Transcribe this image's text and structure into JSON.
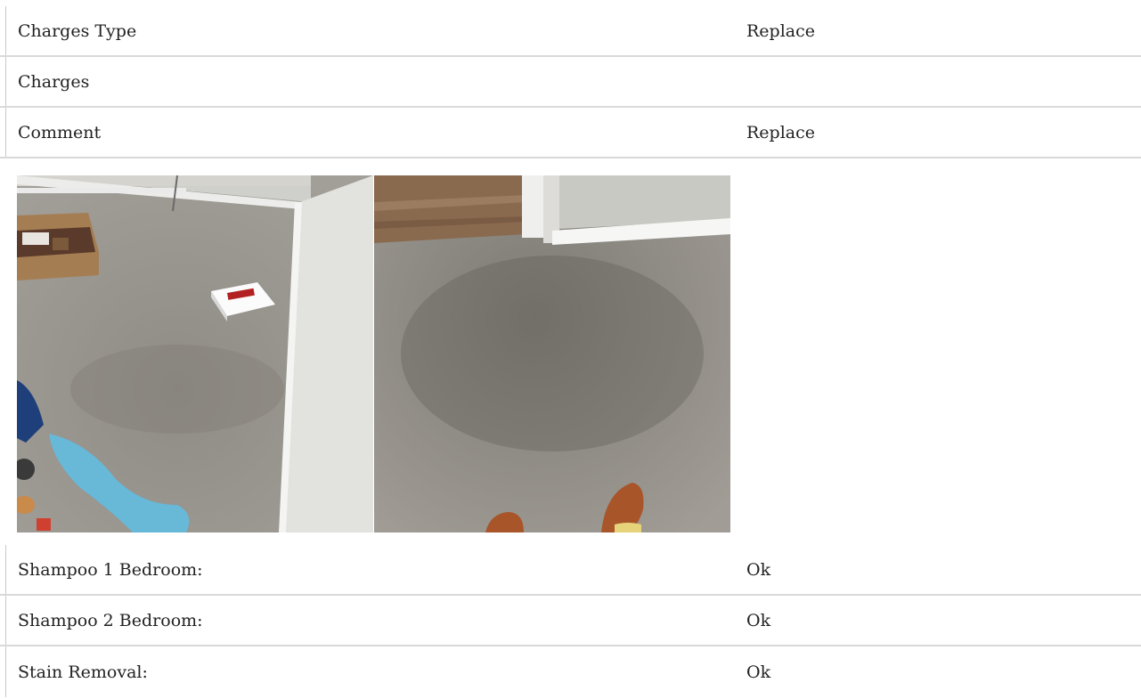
{
  "details_table": {
    "rows": [
      {
        "label": "Charges Type",
        "value": "Replace"
      },
      {
        "label": "Charges",
        "value": ""
      },
      {
        "label": "Comment",
        "value": "Replace"
      }
    ]
  },
  "photos": [
    {
      "name": "carpet-photo-1"
    },
    {
      "name": "carpet-photo-2"
    }
  ],
  "services_table": {
    "rows": [
      {
        "label": "Shampoo 1 Bedroom:",
        "value": "Ok"
      },
      {
        "label": "Shampoo 2 Bedroom:",
        "value": "Ok"
      },
      {
        "label": "Stain Removal:",
        "value": "Ok"
      }
    ]
  }
}
